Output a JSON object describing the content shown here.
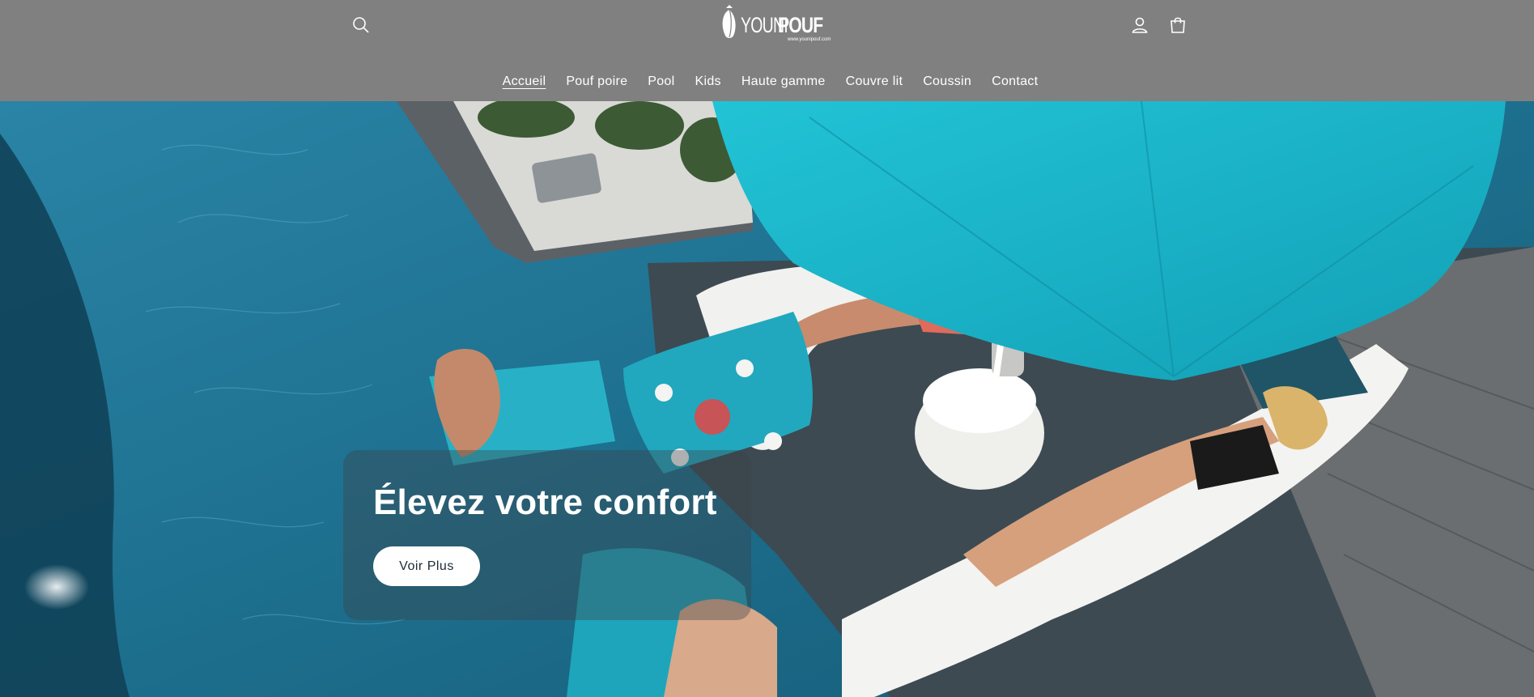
{
  "header": {
    "logo": {
      "name_light": "YOUNI",
      "name_bold": "POUF",
      "url": "www.younipouf.com"
    },
    "icons": {
      "search": "search-icon",
      "account": "user-icon",
      "cart": "cart-icon"
    }
  },
  "nav": {
    "items": [
      {
        "label": "Accueil",
        "active": true
      },
      {
        "label": "Pouf poire",
        "active": false
      },
      {
        "label": "Pool",
        "active": false
      },
      {
        "label": "Kids",
        "active": false
      },
      {
        "label": "Haute gamme",
        "active": false
      },
      {
        "label": "Couvre lit",
        "active": false
      },
      {
        "label": "Coussin",
        "active": false
      },
      {
        "label": "Contact",
        "active": false
      }
    ]
  },
  "hero": {
    "title": "Élevez votre confort",
    "button_label": "Voir Plus"
  },
  "colors": {
    "header_bg": "#808080",
    "pool_water": "#1c6f8f",
    "umbrella": "#19b6c9",
    "text_light": "#ffffff"
  }
}
